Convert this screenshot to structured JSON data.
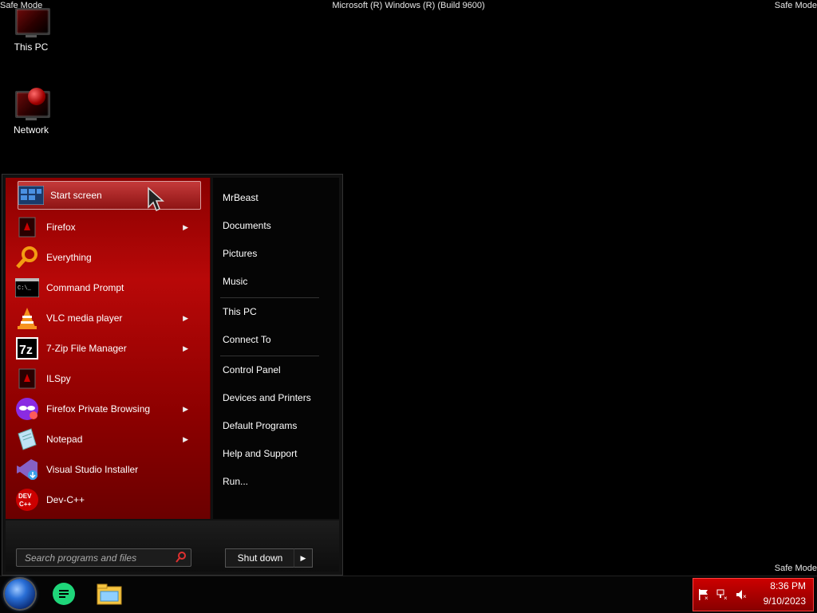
{
  "watermark": {
    "top_left": "Safe Mode",
    "top_center": "Microsoft (R) Windows (R) (Build 9600)",
    "top_right": "Safe Mode",
    "bottom_right": "Safe Mode"
  },
  "desktop": {
    "icons": [
      {
        "label": "This PC",
        "icon": "this-pc-icon"
      },
      {
        "label": "Network",
        "icon": "network-icon"
      }
    ]
  },
  "start_menu": {
    "programs": [
      {
        "label": "Start screen",
        "icon": "start-screen-icon",
        "submenu": false,
        "highlighted": true
      },
      {
        "label": "Firefox",
        "icon": "firefox-icon",
        "submenu": true
      },
      {
        "label": "Everything",
        "icon": "everything-icon",
        "submenu": false
      },
      {
        "label": "Command Prompt",
        "icon": "command-prompt-icon",
        "submenu": false
      },
      {
        "label": "VLC media player",
        "icon": "vlc-icon",
        "submenu": true
      },
      {
        "label": "7-Zip File Manager",
        "icon": "7zip-icon",
        "submenu": true
      },
      {
        "label": "ILSpy",
        "icon": "ilspy-icon",
        "submenu": false
      },
      {
        "label": "Firefox Private Browsing",
        "icon": "firefox-private-icon",
        "submenu": true
      },
      {
        "label": "Notepad",
        "icon": "notepad-icon",
        "submenu": true
      },
      {
        "label": "Visual Studio Installer",
        "icon": "visual-studio-installer-icon",
        "submenu": false
      },
      {
        "label": "Dev-C++",
        "icon": "devcpp-icon",
        "submenu": false
      }
    ],
    "places": {
      "user": "MrBeast",
      "documents": "Documents",
      "pictures": "Pictures",
      "music": "Music",
      "this_pc": "This PC",
      "connect_to": "Connect To",
      "control_panel": "Control Panel",
      "devices_printers": "Devices and Printers",
      "default_programs": "Default Programs",
      "help_support": "Help and Support",
      "run": "Run..."
    },
    "search_placeholder": "Search programs and files",
    "shutdown_label": "Shut down",
    "submenu_glyph": "▶"
  },
  "taskbar": {
    "apps": [
      {
        "icon": "notes-app-icon"
      },
      {
        "icon": "file-explorer-icon"
      }
    ],
    "clock": {
      "time": "8:36 PM",
      "date": "9/10/2023"
    }
  },
  "colors": {
    "accent": "#b80808",
    "tray": "#c00000"
  }
}
